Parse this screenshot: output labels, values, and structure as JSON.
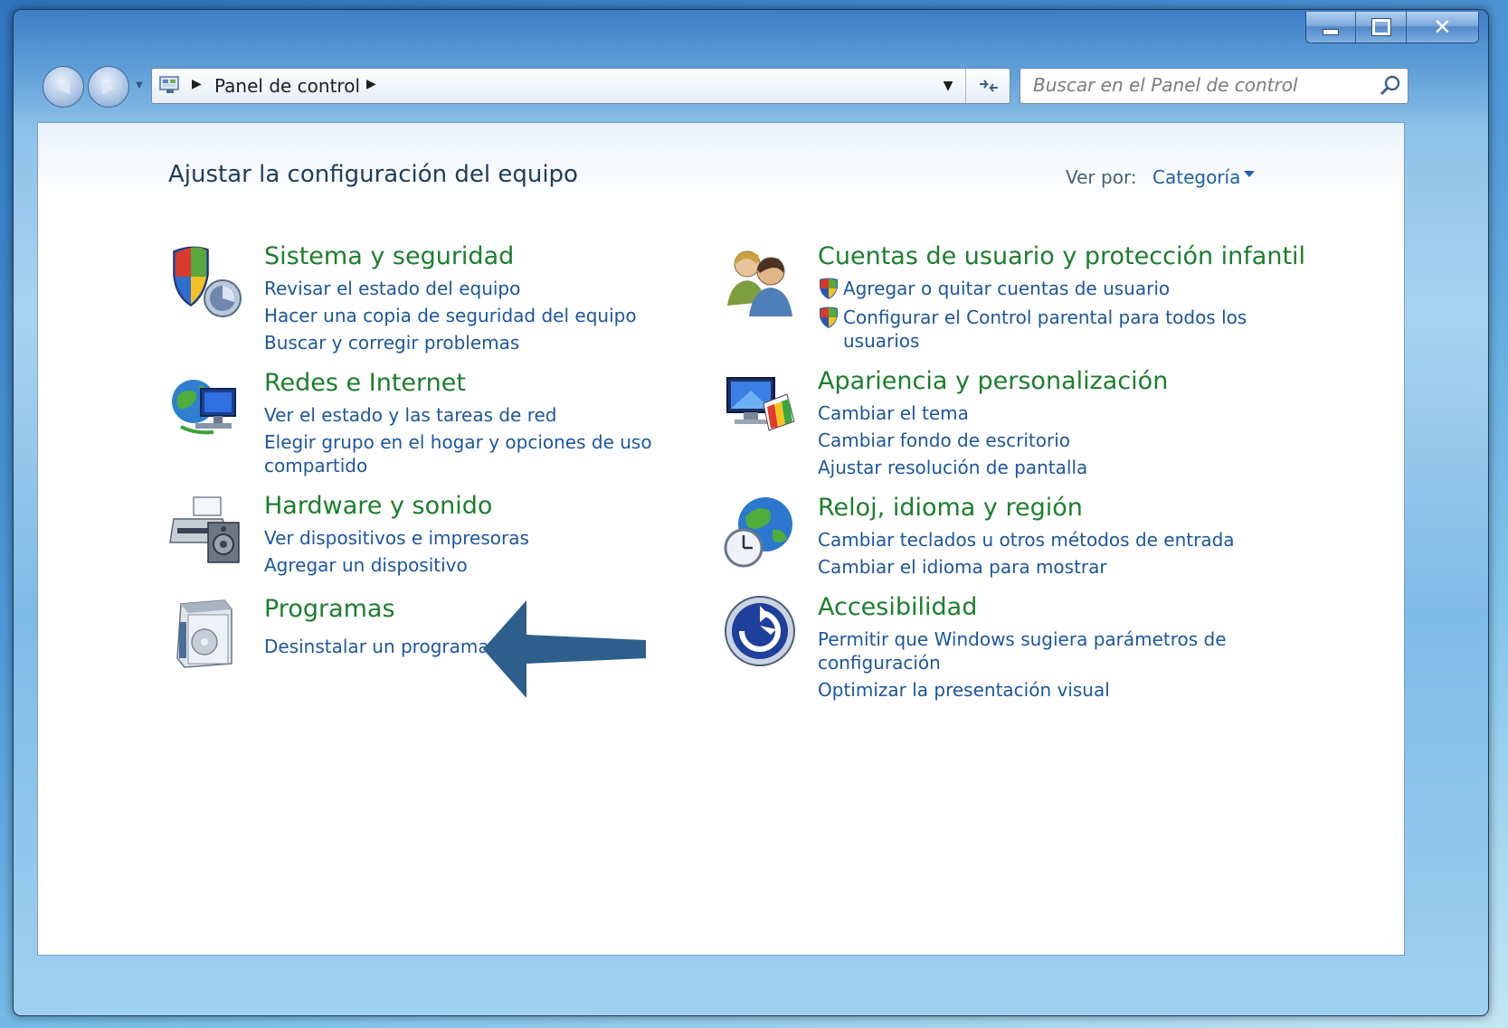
{
  "window": {
    "caption": {
      "minimize": "minimize",
      "maximize": "maximize",
      "close": "✕"
    }
  },
  "address": {
    "path": "Panel de control"
  },
  "search": {
    "placeholder": "Buscar en el Panel de control"
  },
  "header": {
    "title": "Ajustar la configuración del equipo",
    "view_by_label": "Ver por:",
    "view_by_value": "Categoría"
  },
  "categories": {
    "system": {
      "title": "Sistema y seguridad",
      "links": [
        "Revisar el estado del equipo",
        "Hacer una copia de seguridad del equipo",
        "Buscar y corregir problemas"
      ]
    },
    "network": {
      "title": "Redes e Internet",
      "links": [
        "Ver el estado y las tareas de red",
        "Elegir grupo en el hogar y opciones de uso",
        "compartido"
      ]
    },
    "hardware": {
      "title": "Hardware y sonido",
      "links": [
        "Ver dispositivos e impresoras",
        "Agregar un dispositivo"
      ]
    },
    "programs": {
      "title": "Programas",
      "links": [
        "Desinstalar un programa"
      ]
    },
    "users": {
      "title": "Cuentas de usuario y protección infantil",
      "links": [
        "Agregar o quitar cuentas de usuario",
        "Configurar el Control parental para todos los",
        "usuarios"
      ]
    },
    "appearance": {
      "title": "Apariencia y personalización",
      "links": [
        "Cambiar el tema",
        "Cambiar fondo de escritorio",
        "Ajustar resolución de pantalla"
      ]
    },
    "clock": {
      "title": "Reloj, idioma y región",
      "links": [
        "Cambiar teclados u otros métodos de entrada",
        "Cambiar el idioma para mostrar"
      ]
    },
    "accessibility": {
      "title": "Accesibilidad",
      "links": [
        "Permitir que Windows sugiera parámetros de",
        "configuración",
        "Optimizar la presentación visual"
      ]
    }
  },
  "colors": {
    "category_title": "#1c7e2d",
    "link": "#1c56a0",
    "annotation_arrow": "#2e5f8c"
  }
}
